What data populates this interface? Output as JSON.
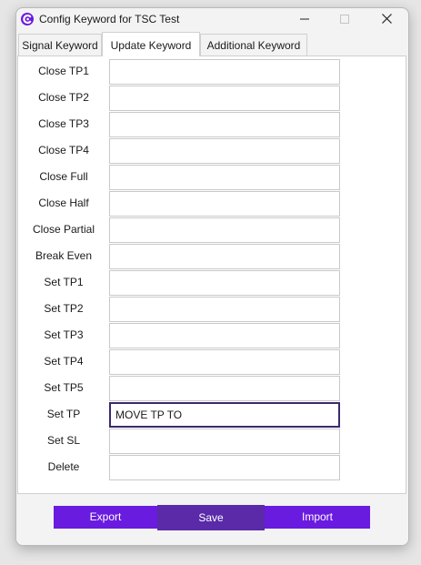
{
  "window": {
    "title": "Config Keyword for TSC Test",
    "icons": {
      "app": "app-logo-icon",
      "minimize": "minimize-icon",
      "maximize": "maximize-icon",
      "close": "close-icon"
    },
    "colors": {
      "accent": "#6a1be0",
      "save": "#5a2aa8",
      "focus_border": "#3b2a6e"
    }
  },
  "tabs": [
    {
      "label": "Signal Keyword",
      "active": false
    },
    {
      "label": "Update Keyword",
      "active": true
    },
    {
      "label": "Additional Keyword",
      "active": false
    }
  ],
  "fields": [
    {
      "label": "Close TP1",
      "value": ""
    },
    {
      "label": "Close TP2",
      "value": ""
    },
    {
      "label": "Close TP3",
      "value": ""
    },
    {
      "label": "Close TP4",
      "value": ""
    },
    {
      "label": "Close Full",
      "value": ""
    },
    {
      "label": "Close Half",
      "value": ""
    },
    {
      "label": "Close Partial",
      "value": ""
    },
    {
      "label": "Break Even",
      "value": ""
    },
    {
      "label": "Set TP1",
      "value": ""
    },
    {
      "label": "Set TP2",
      "value": ""
    },
    {
      "label": "Set TP3",
      "value": ""
    },
    {
      "label": "Set TP4",
      "value": ""
    },
    {
      "label": "Set TP5",
      "value": ""
    },
    {
      "label": "Set TP",
      "value": "MOVE TP TO"
    },
    {
      "label": "Set SL",
      "value": ""
    },
    {
      "label": "Delete",
      "value": ""
    }
  ],
  "footer": {
    "export_label": "Export",
    "save_label": "Save",
    "import_label": "Import"
  }
}
